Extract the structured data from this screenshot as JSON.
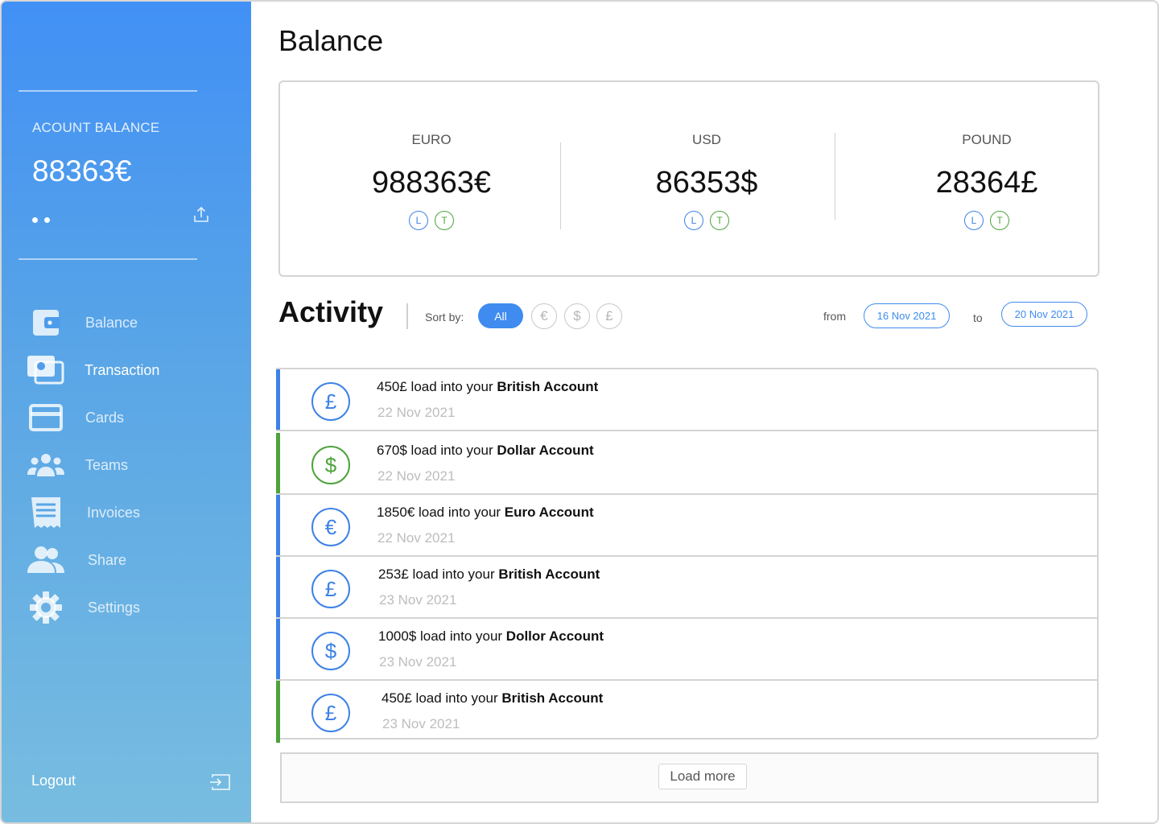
{
  "sidebar": {
    "account_label": "ACOUNT BALANCE",
    "account_amount": "88363€",
    "nav": [
      {
        "label": "Balance",
        "icon": "wallet-icon",
        "active": false
      },
      {
        "label": "Transaction",
        "icon": "money-icon",
        "active": true
      },
      {
        "label": "Cards",
        "icon": "credit-card-icon",
        "active": false
      },
      {
        "label": "Teams",
        "icon": "team-icon",
        "active": false
      },
      {
        "label": "Invoices",
        "icon": "invoice-icon",
        "active": false
      },
      {
        "label": "Share",
        "icon": "users-icon",
        "active": false
      },
      {
        "label": "Settings",
        "icon": "gear-icon",
        "active": false
      }
    ],
    "logout_label": "Logout"
  },
  "main": {
    "title": "Balance",
    "balances": [
      {
        "currency": "EURO",
        "amount": "988363€",
        "badges": [
          "L",
          "T"
        ]
      },
      {
        "currency": "USD",
        "amount": "86353$",
        "badges": [
          "L",
          "T"
        ]
      },
      {
        "currency": "POUND",
        "amount": "28364£",
        "badges": [
          "L",
          "T"
        ]
      }
    ],
    "activity": {
      "title": "Activity",
      "sort_label": "Sort by:",
      "filter_all": "All",
      "filters": [
        "€",
        "$",
        "£"
      ],
      "from_label": "from",
      "from_date": "16 Nov 2021",
      "to_label": "to",
      "to_date": "20 Nov 2021",
      "transactions": [
        {
          "symbol": "£",
          "prefix": "450£ load into your",
          "account": "British Account",
          "date": "22 Nov 2021",
          "color": "#3d82e6",
          "bar": "#3d82e6"
        },
        {
          "symbol": "$",
          "prefix": "670$ load into your",
          "account": "Dollar Account",
          "date": "22 Nov 2021",
          "color": "#4da33c",
          "bar": "#4da33c"
        },
        {
          "symbol": "€",
          "prefix": "1850€ load into your",
          "account": "Euro Account",
          "date": "22 Nov 2021",
          "color": "#3d82e6",
          "bar": "#3d82e6"
        },
        {
          "symbol": "£",
          "prefix": "253£ load into your",
          "account": "British Account",
          "date": "23 Nov 2021",
          "color": "#3d82e6",
          "bar": "#3d82e6"
        },
        {
          "symbol": "$",
          "prefix": "1000$ load into your",
          "account": "Dollor Account",
          "date": "23 Nov 2021",
          "color": "#3d82e6",
          "bar": "#3d82e6"
        },
        {
          "symbol": "£",
          "prefix": "450£ load into your",
          "account": "British Account",
          "date": "23 Nov 2021",
          "color": "#3d82e6",
          "bar": "#4da33c"
        }
      ],
      "load_more_label": "Load more"
    }
  }
}
